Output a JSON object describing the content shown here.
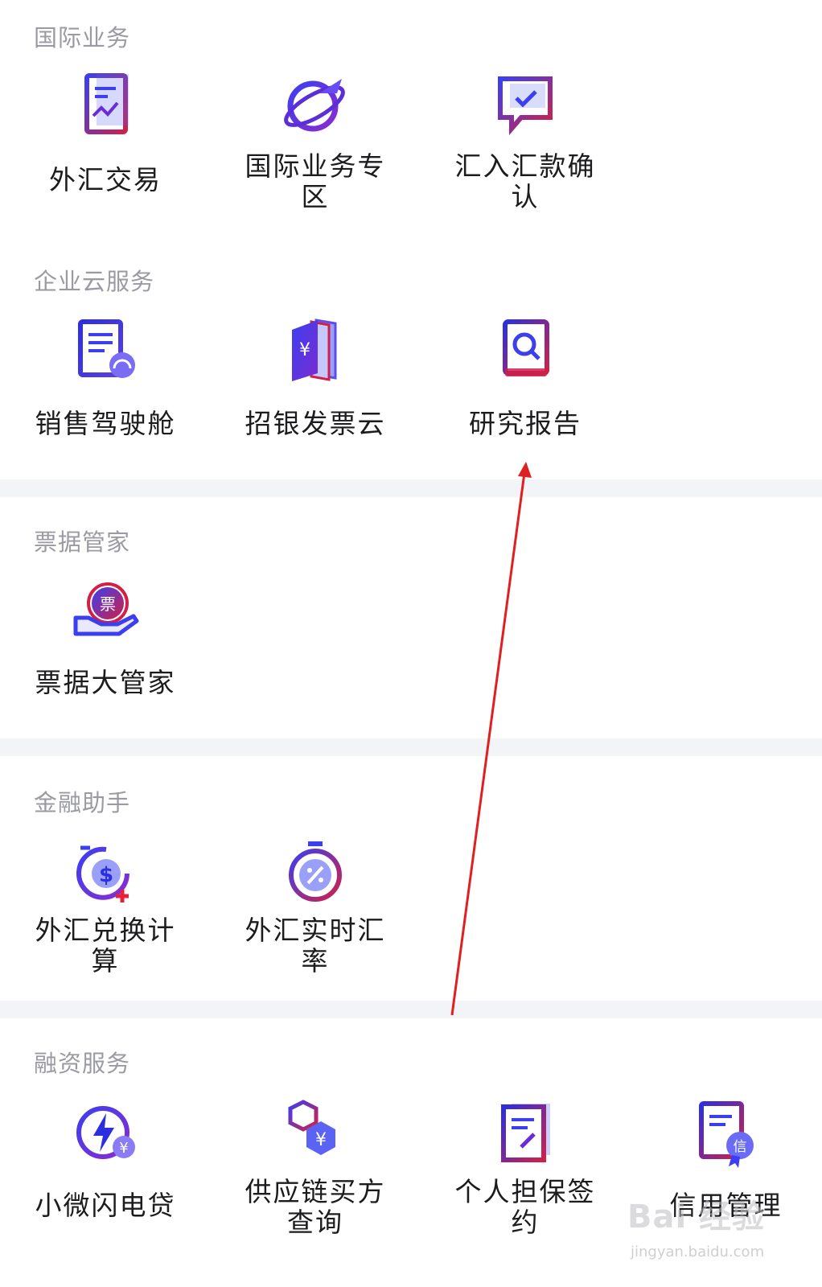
{
  "sections": [
    {
      "title": "国际业务",
      "items": [
        {
          "label": "外汇交易",
          "icon": "forex-trade-icon"
        },
        {
          "label": "国际业务专区",
          "icon": "globe-plane-icon"
        },
        {
          "label": "汇入汇款确认",
          "icon": "chat-check-icon"
        }
      ]
    },
    {
      "title": "企业云服务",
      "items": [
        {
          "label": "销售驾驶舱",
          "icon": "sales-dashboard-icon"
        },
        {
          "label": "招银发票云",
          "icon": "invoice-book-icon"
        },
        {
          "label": "研究报告",
          "icon": "research-report-icon"
        }
      ]
    },
    {
      "title": "票据管家",
      "items": [
        {
          "label": "票据大管家",
          "icon": "bill-hand-icon",
          "badge": "票"
        }
      ]
    },
    {
      "title": "金融助手",
      "items": [
        {
          "label": "外汇兑换计算",
          "icon": "dollar-timer-icon"
        },
        {
          "label": "外汇实时汇率",
          "icon": "percent-stopwatch-icon"
        }
      ]
    },
    {
      "title": "融资服务",
      "items": [
        {
          "label": "小微闪电贷",
          "icon": "lightning-yen-icon"
        },
        {
          "label": "供应链买方查询",
          "icon": "hexagon-yen-icon"
        },
        {
          "label": "个人担保签约",
          "icon": "sign-document-icon"
        },
        {
          "label": "信用管理",
          "icon": "credit-certificate-icon",
          "badge": "信"
        }
      ]
    }
  ],
  "watermark": {
    "text": "Bai 经验",
    "sub": "jingyan.baidu.com"
  },
  "colors": {
    "accent_blue": "#3b3ff0",
    "accent_purple": "#6a2cd8",
    "accent_red": "#e5213b",
    "annotation_arrow": "#e02020"
  }
}
